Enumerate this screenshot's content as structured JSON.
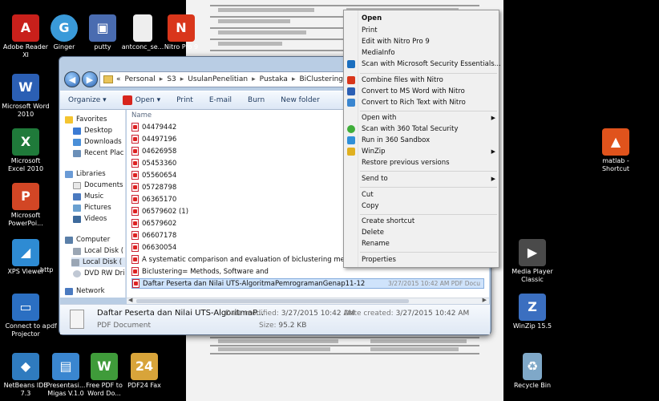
{
  "desktop": {
    "left_icons": [
      {
        "label": "Adobe Reader XI",
        "icon": "adobe-reader-icon",
        "color": "#c8201b"
      },
      {
        "label": "Ginger",
        "icon": "ginger-icon",
        "color": "#3a9ad9"
      },
      {
        "label": "putty",
        "icon": "putty-icon",
        "color": "#4a6cb0"
      },
      {
        "label": "antconc_se...",
        "icon": "file-icon",
        "color": "#eeeeee"
      },
      {
        "label": "Nitro Pro 9",
        "icon": "nitro-icon",
        "color": "#d9361b"
      },
      {
        "label": "Microsoft Word 2010",
        "icon": "word-icon",
        "color": "#2b5fb4"
      },
      {
        "label": "Microsoft Excel 2010",
        "icon": "excel-icon",
        "color": "#1f7a3a"
      },
      {
        "label": "Microsoft PowerPoi...",
        "icon": "powerpoint-icon",
        "color": "#d24625"
      },
      {
        "label": "XPS Viewer",
        "icon": "xps-viewer-icon",
        "color": "#2e8bd3"
      },
      {
        "label": "Connect to a Projector",
        "icon": "projector-icon",
        "color": "#2b6fc2"
      },
      {
        "label": "NetBeans IDE 7.3",
        "icon": "netbeans-icon",
        "color": "#2f7bbf"
      },
      {
        "label": "Presentasi... Migas V.1.0",
        "icon": "presentation-icon",
        "color": "#3a86d0"
      },
      {
        "label": "Free PDF to Word Do...",
        "icon": "pdf-to-word-icon",
        "color": "#3f9b3a"
      },
      {
        "label": "PDF24 Fax",
        "icon": "pdf24-icon",
        "color": "#d8a43a"
      }
    ],
    "right_icons": [
      {
        "label": "matlab - Shortcut",
        "icon": "matlab-icon",
        "color": "#e0531c"
      },
      {
        "label": "Media Player Classic",
        "icon": "media-player-icon",
        "color": "#4a4a4a"
      },
      {
        "label": "WinZip 15.5",
        "icon": "winzip-icon",
        "color": "#3b6fc0"
      },
      {
        "label": "Recycle Bin",
        "icon": "recycle-bin-icon",
        "color": "#7fa8c8"
      }
    ],
    "partial_labels": [
      "http",
      "pdf"
    ]
  },
  "explorer": {
    "breadcrumb": [
      "Personal",
      "S3",
      "UsulanPenelitian",
      "Pustaka",
      "BiClustering"
    ],
    "breadcrumb_prefix": "«",
    "toolbar": {
      "organize": "Organize ▾",
      "open": "Open ▾",
      "print": "Print",
      "email": "E-mail",
      "burn": "Burn",
      "new_folder": "New folder"
    },
    "nav": {
      "favorites": "Favorites",
      "desktop": "Desktop",
      "downloads": "Downloads",
      "recent": "Recent Plac",
      "libraries": "Libraries",
      "documents": "Documents",
      "music": "Music",
      "pictures": "Pictures",
      "videos": "Videos",
      "computer": "Computer",
      "local_disk_c": "Local Disk (",
      "local_disk_d": "Local Disk (",
      "dvd": "DVD RW Dri",
      "network": "Network"
    },
    "column_name": "Name",
    "files": [
      "04479442",
      "04497196",
      "04626958",
      "05453360",
      "05560654",
      "05728798",
      "06365170",
      "06579602 (1)",
      "06579602",
      "06607178",
      "06630054",
      "A systematic comparison and evaluation of biclustering methods for gene",
      "Biclustering= Methods, Software and",
      "Daftar Peserta dan Nilai UTS-AlgoritmaPemrogramanGenap11-12"
    ],
    "selected_meta": "3/27/2015 10:42 AM    PDF Docu",
    "details": {
      "name": "Daftar Peserta dan Nilai UTS-AlgoritmaP...",
      "type": "PDF Document",
      "modified_label": "Date modified:",
      "modified": "3/27/2015 10:42 AM",
      "size_label": "Size:",
      "size": "95.2 KB",
      "created_label": "Date created:",
      "created": "3/27/2015 10:42 AM"
    }
  },
  "context_menu": {
    "open": "Open",
    "print": "Print",
    "edit_nitro": "Edit with Nitro Pro 9",
    "mediainfo": "MediaInfo",
    "scan_mse": "Scan with Microsoft Security Essentials...",
    "combine_nitro": "Combine files with Nitro",
    "convert_word": "Convert to MS Word with Nitro",
    "convert_rtf": "Convert to Rich Text with Nitro",
    "open_with": "Open with",
    "scan_360": "Scan with 360 Total Security",
    "run_sandbox": "Run in 360 Sandbox",
    "winzip": "WinZip",
    "restore": "Restore previous versions",
    "send_to": "Send to",
    "cut": "Cut",
    "copy": "Copy",
    "create_shortcut": "Create shortcut",
    "delete": "Delete",
    "rename": "Rename",
    "properties": "Properties"
  }
}
